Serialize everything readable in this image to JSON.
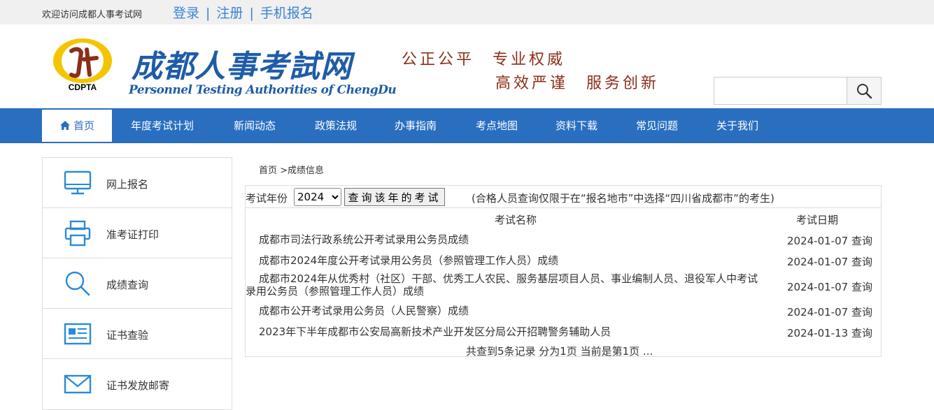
{
  "topbar": {
    "welcome": "欢迎访问成都人事考试网",
    "login": "登录",
    "register": "注册",
    "mobile_signup": "手机报名"
  },
  "header": {
    "logo_abbr": "CDPTA",
    "logo_title": "成都人事考試网",
    "logo_subtitle": "Personnel Testing Authorities of ChengDu",
    "slogan_line1": "公正公平　专业权威",
    "slogan_line2": "高效严谨　服务创新",
    "search_placeholder": ""
  },
  "nav": {
    "items": [
      {
        "label": "首页",
        "active": true
      },
      {
        "label": "年度考试计划"
      },
      {
        "label": "新闻动态"
      },
      {
        "label": "政策法规"
      },
      {
        "label": "办事指南"
      },
      {
        "label": "考点地图"
      },
      {
        "label": "资料下载"
      },
      {
        "label": "常见问题"
      },
      {
        "label": "关于我们"
      }
    ]
  },
  "sidebar": {
    "items": [
      {
        "label": "网上报名",
        "icon": "monitor-icon"
      },
      {
        "label": "准考证打印",
        "icon": "printer-icon"
      },
      {
        "label": "成绩查询",
        "icon": "search-icon"
      },
      {
        "label": "证书查验",
        "icon": "certificate-icon"
      },
      {
        "label": "证书发放邮寄",
        "icon": "mail-icon"
      }
    ]
  },
  "breadcrumb": "首页 >成绩信息",
  "filter": {
    "year_label": "考试年份",
    "year_selected": "2024",
    "query_button": "查询该年的考试",
    "note": "(合格人员查询仅限于在“报名地市”中选择“四川省成都市”的考生)"
  },
  "table": {
    "col_name": "考试名称",
    "col_date": "考试日期",
    "query_text": "查询",
    "rows": [
      {
        "name": "成都市司法行政系统公开考试录用公务员成绩",
        "date": "2024-01-07"
      },
      {
        "name": "成都市2024年度公开考试录用公务员（参照管理工作人员）成绩",
        "date": "2024-01-07"
      },
      {
        "name": "成都市2024年从优秀村（社区）干部、优秀工人农民、服务基层项目人员、事业编制人员、退役军人中考试录用公务员（参照管理工作人员）成绩",
        "date": "2024-01-07"
      },
      {
        "name": "成都市公开考试录用公务员（人民警察）成绩",
        "date": "2024-01-07"
      },
      {
        "name": "2023年下半年成都市公安局高新技术产业开发区分局公开招聘警务辅助人员",
        "date": "2024-01-13"
      }
    ]
  },
  "pager": "共查到5条记录 分为1页 当前是第1页 ...",
  "colors": {
    "nav_blue": "#2a6ec0",
    "link_blue": "#3a83d2",
    "slogan_red": "#8b2e1a",
    "logo_yellow": "#f5c400"
  }
}
